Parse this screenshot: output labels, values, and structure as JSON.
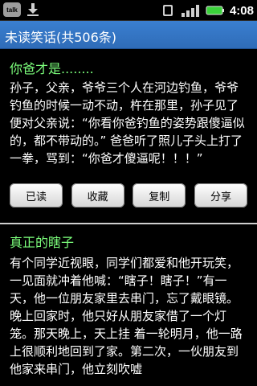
{
  "status_bar": {
    "left_icons": [
      "talk-icon",
      "download-icon"
    ],
    "talk_label": "talk",
    "right_icons": [
      "sync-icon",
      "signal-icon",
      "battery-icon"
    ],
    "time": "4:08"
  },
  "app_title": "未读笑话(共506条)",
  "items": [
    {
      "title": "你爸才是........",
      "body": "孙子，父亲，爷爷三个人在河边钓鱼，爷爷钓鱼的时候一动不动，杵在那里，孙子见了便对父亲说：“你看你爸钓鱼的姿势跟傻逼似的，都不带动的。” 爸爸听了照儿子头上打了一拳，骂到：“你爸才傻逼呢！！！”",
      "buttons": [
        "已读",
        "收藏",
        "复制",
        "分享"
      ]
    },
    {
      "title": "真正的瞎子",
      "body": "有个同学近视眼，同学们都爱和他开玩笑，一见面就冲着他喊：“瞎子！瞎子！”有一天，他一位朋友家里去串门，忘了戴眼镜。晚上回家时，他只好从朋友家借了一个灯笼。那天晚上，天上挂 着一轮明月，他一路上很顺利地回到了家。第二次，一伙朋友到他家来串门，他立刻吹嘘"
    }
  ]
}
